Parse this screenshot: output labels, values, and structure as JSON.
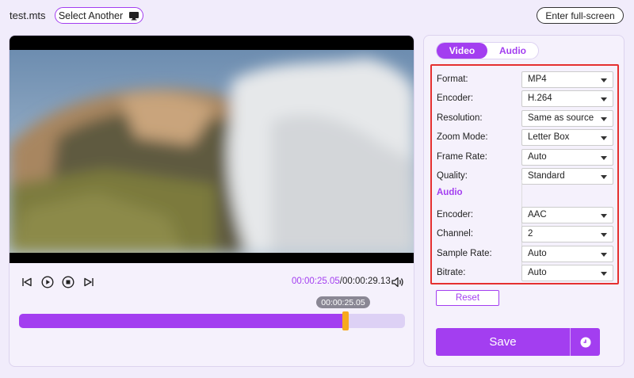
{
  "header": {
    "filename": "test.mts",
    "select_another_label": "Select Another",
    "fullscreen_label": "Enter full-screen"
  },
  "player": {
    "current_time": "00:00:25.05",
    "separator": "/",
    "total_time": "00:00:29.13",
    "tooltip_time": "00:00:25.05",
    "progress": 0.847
  },
  "tabs": [
    {
      "label": "Video",
      "active": true
    },
    {
      "label": "Audio",
      "active": false
    }
  ],
  "video_settings": [
    {
      "label": "Format:",
      "value": "MP4"
    },
    {
      "label": "Encoder:",
      "value": "H.264"
    },
    {
      "label": "Resolution:",
      "value": "Same as source"
    },
    {
      "label": "Zoom Mode:",
      "value": "Letter Box"
    },
    {
      "label": "Frame Rate:",
      "value": "Auto"
    },
    {
      "label": "Quality:",
      "value": "Standard"
    }
  ],
  "audio_heading": "Audio",
  "audio_settings": [
    {
      "label": "Encoder:",
      "value": "AAC"
    },
    {
      "label": "Channel:",
      "value": "2"
    },
    {
      "label": "Sample Rate:",
      "value": "Auto"
    },
    {
      "label": "Bitrate:",
      "value": "Auto"
    }
  ],
  "actions": {
    "reset_label": "Reset",
    "save_label": "Save"
  },
  "colors": {
    "accent": "#a33ef0",
    "playhead": "#f7a91e",
    "highlight_border": "#e53030",
    "background": "#f1ecfb"
  }
}
